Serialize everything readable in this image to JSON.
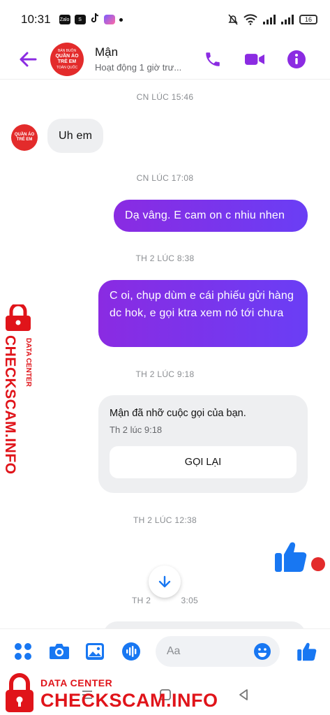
{
  "status_bar": {
    "time": "10:31",
    "battery": "16",
    "apps": [
      "Zalo",
      "S"
    ]
  },
  "header": {
    "contact_name": "Mận",
    "contact_status": "Hoạt động 1 giờ trư...",
    "avatar_lines": [
      "BÁN BUÔN",
      "QUẦN ÁO",
      "TRẺ EM",
      "TOÀN QUỐC"
    ],
    "accent_color": "#8b2be2",
    "icons": [
      "back-arrow-icon",
      "phone-icon",
      "video-icon",
      "info-icon"
    ]
  },
  "messages": {
    "ts1": "CN LÚC 15:46",
    "msg1": "Uh em",
    "ts2": "CN LÚC 17:08",
    "msg2": "Dạ vâng. E cam on c nhiu nhen",
    "ts3": "TH 2 LÚC 8:38",
    "msg3": "C oi, chụp dùm e cái phiếu gửi hàng dc hok, e gọi ktra xem nó tới chưa",
    "ts4": "TH 2 LÚC 9:18",
    "call_text": "Mận đã nhỡ cuộc gọi của bạn.",
    "call_time": "Th 2 lúc 9:18",
    "call_button": "GỌI LẠI",
    "ts5": "TH 2 LÚC 12:38",
    "ts6_left": "TH 2",
    "ts6_right": "3:05"
  },
  "composer": {
    "placeholder": "Aa",
    "icons": [
      "apps-icon",
      "camera-icon",
      "image-icon",
      "mic-icon",
      "emoji-icon",
      "like-icon"
    ]
  },
  "watermark": {
    "side_small": "DATA CENTER",
    "side_big": "CHECKSCAM.INFO",
    "bottom_small": "DATA CENTER",
    "bottom_big": "CHECKSCAM.INFO",
    "color": "#e0141a"
  }
}
